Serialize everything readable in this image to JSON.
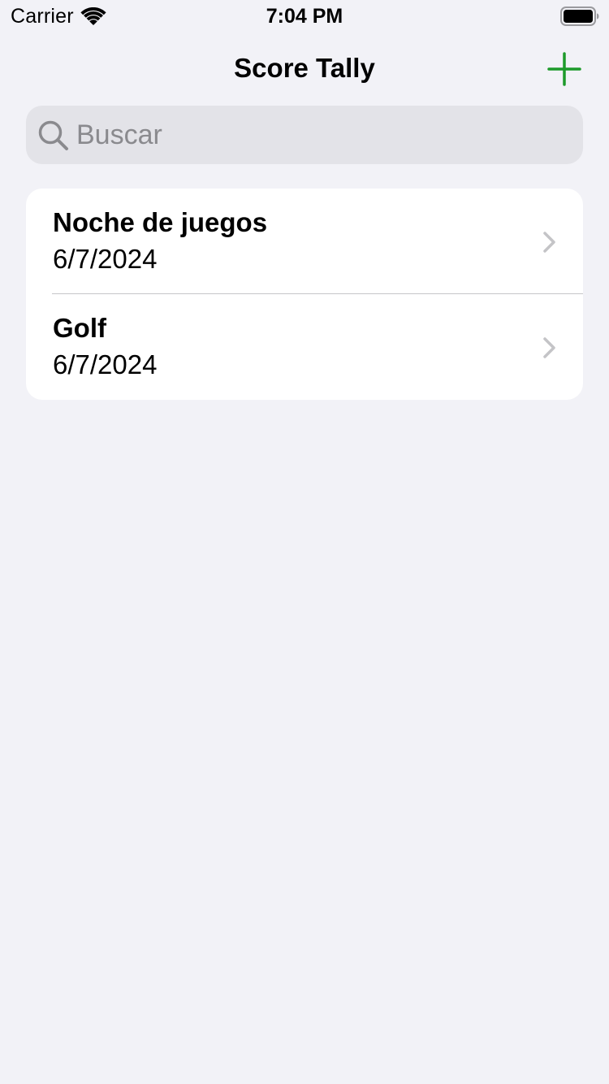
{
  "status_bar": {
    "carrier": "Carrier",
    "time": "7:04 PM",
    "icons": [
      "wifi-icon",
      "battery-icon"
    ]
  },
  "nav": {
    "title": "Score Tally",
    "add_icon": "plus-icon",
    "accent_color": "#1d9a2a"
  },
  "search": {
    "placeholder": "Buscar",
    "value": "",
    "icon": "magnifying-glass-icon"
  },
  "games": [
    {
      "title": "Noche de juegos",
      "date": "6/7/2024"
    },
    {
      "title": "Golf",
      "date": "6/7/2024"
    }
  ],
  "colors": {
    "background": "#f2f2f7",
    "card": "#ffffff",
    "search_field": "#e3e3e8",
    "chevron": "#c4c4c7"
  }
}
